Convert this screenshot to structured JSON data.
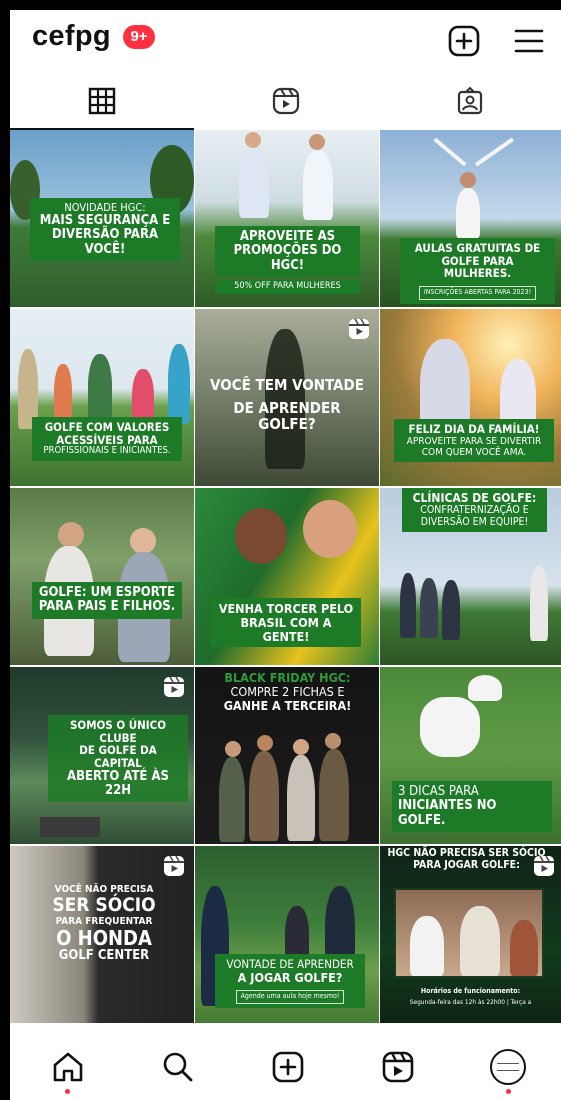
{
  "header": {
    "username": "cefpg",
    "notification_badge": "9+",
    "icons": [
      "add-icon",
      "menu-icon"
    ]
  },
  "tabs": [
    {
      "name": "posts-grid",
      "icon": "grid-icon",
      "active": true
    },
    {
      "name": "reels",
      "icon": "reels-icon",
      "active": false
    },
    {
      "name": "tagged",
      "icon": "tagged-icon",
      "active": false
    }
  ],
  "posts": [
    {
      "lines": [
        "NOVIDADE HGC:",
        "MAIS SEGURANÇA E",
        "DIVERSÃO PARA VOCÊ!"
      ],
      "sub": "",
      "reel": false
    },
    {
      "lines": [
        "APROVEITE AS",
        "PROMOÇÕES DO HGC!"
      ],
      "sub": "50% OFF PARA MULHERES",
      "reel": false
    },
    {
      "lines": [
        "AULAS GRATUITAS DE",
        "GOLFE PARA MULHERES."
      ],
      "sub": "INSCRIÇÕES ABERTAS PARA 2023!",
      "reel": false
    },
    {
      "lines": [
        "GOLFE COM VALORES",
        "ACESSÍVEIS PARA",
        "PROFISSIONAIS E INICIANTES."
      ],
      "sub": "",
      "reel": false
    },
    {
      "lines": [
        "VOCÊ TEM VONTADE",
        "DE APRENDER GOLFE?"
      ],
      "sub": "",
      "reel": true
    },
    {
      "lines": [
        "FELIZ DIA DA FAMÍLIA!",
        "APROVEITE PARA SE DIVERTIR",
        "COM QUEM VOCÊ AMA."
      ],
      "sub": "",
      "reel": false
    },
    {
      "lines": [
        "GOLFE: UM ESPORTE",
        "PARA PAIS E FILHOS."
      ],
      "sub": "",
      "reel": false
    },
    {
      "lines": [
        "VENHA TORCER PELO",
        "BRASIL COM A GENTE!"
      ],
      "sub": "",
      "reel": false
    },
    {
      "lines": [
        "CLÍNICAS DE GOLFE:",
        "CONFRATERNIZAÇÃO E",
        "DIVERSÃO EM EQUIPE!"
      ],
      "sub": "",
      "reel": false
    },
    {
      "lines": [
        "SOMOS O ÚNICO CLUBE",
        "DE GOLFE DA CAPITAL",
        "ABERTO ATÉ ÀS 22H"
      ],
      "sub": "",
      "reel": true
    },
    {
      "lines": [
        "BLACK FRIDAY HGC:",
        "COMPRE 2 FICHAS E",
        "GANHE A TERCEIRA!"
      ],
      "sub": "",
      "reel": false
    },
    {
      "lines": [
        "3 DICAS PARA",
        "INICIANTES NO GOLFE."
      ],
      "sub": "",
      "reel": false
    },
    {
      "lines": [
        "VOCÊ NÃO PRECISA",
        "SER SÓCIO",
        "PARA FREQUENTAR",
        "O HONDA",
        "GOLF CENTER"
      ],
      "sub": "",
      "reel": true
    },
    {
      "lines": [
        "VONTADE DE APRENDER",
        "A JOGAR GOLFE?"
      ],
      "sub": "Agende uma aula hoje mesmo!",
      "reel": false
    },
    {
      "lines": [
        "HGC NÃO PRECISA SER SÓCIO",
        "PARA JOGAR GOLFE:"
      ],
      "sub": "Horários de funcionamento:",
      "sub2": "Segunda-feira das 12h às 22h00 | Terça a",
      "reel": true
    }
  ],
  "bottom_nav": [
    {
      "name": "home",
      "icon": "home-icon",
      "dot": true
    },
    {
      "name": "search",
      "icon": "search-icon",
      "dot": false
    },
    {
      "name": "create",
      "icon": "add-icon",
      "dot": false
    },
    {
      "name": "reels",
      "icon": "reels-icon",
      "dot": false
    },
    {
      "name": "profile",
      "icon": "avatar",
      "dot": true
    }
  ],
  "colors": {
    "badge": "#ff3040",
    "caption_green": "#1d7a27",
    "text": "#111111"
  }
}
